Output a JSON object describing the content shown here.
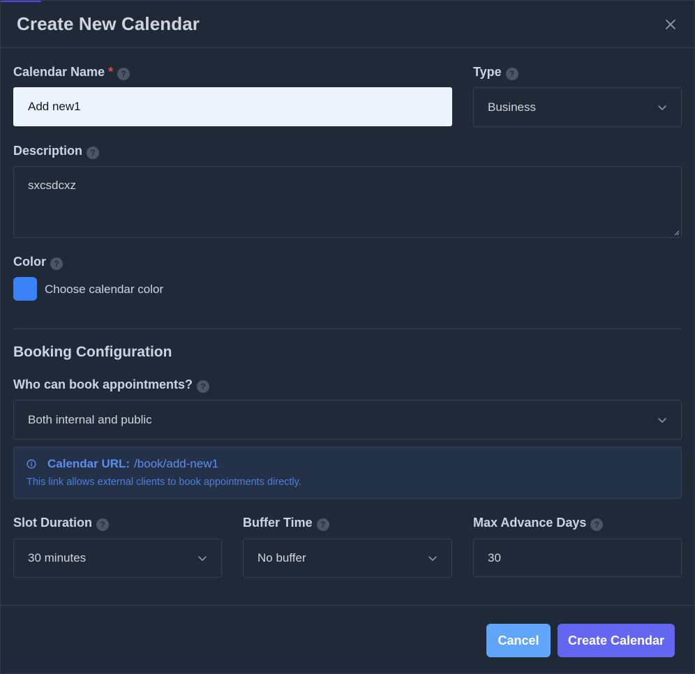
{
  "dialog": {
    "title": "Create New Calendar"
  },
  "fields": {
    "calendar_name": {
      "label": "Calendar Name",
      "required_mark": "*",
      "value": "Add new1"
    },
    "type": {
      "label": "Type",
      "value": "Business"
    },
    "description": {
      "label": "Description",
      "value": "sxcsdcxz"
    },
    "color": {
      "label": "Color",
      "choose_label": "Choose calendar color",
      "value": "#3b82f6"
    }
  },
  "booking": {
    "section_title": "Booking Configuration",
    "who_can_book": {
      "label": "Who can book appointments?",
      "value": "Both internal and public"
    },
    "calendar_url": {
      "label": "Calendar URL:",
      "url": "/book/add-new1",
      "note": "This link allows external clients to book appointments directly."
    },
    "slot_duration": {
      "label": "Slot Duration",
      "value": "30 minutes"
    },
    "buffer_time": {
      "label": "Buffer Time",
      "value": "No buffer"
    },
    "max_advance_days": {
      "label": "Max Advance Days",
      "value": "30"
    }
  },
  "help_icon_text": "?",
  "footer": {
    "cancel_label": "Cancel",
    "create_label": "Create Calendar"
  },
  "colors": {
    "background": "#1f2937",
    "accent": "#6366f1",
    "cancel": "#60a5fa",
    "info": "#5b8ef0",
    "required": "#ef4444"
  },
  "icons": {
    "close": "close-icon",
    "chevron": "chevron-down-icon",
    "help": "help-circle-icon",
    "info": "info-circle-icon"
  }
}
